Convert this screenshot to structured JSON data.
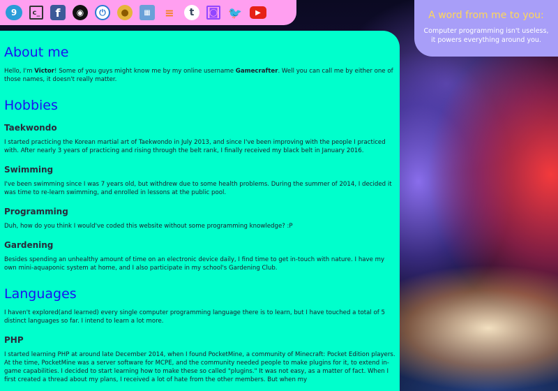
{
  "social_icons": [
    {
      "name": "ninth-icon",
      "glyph": "9"
    },
    {
      "name": "code-icon",
      "glyph": "c_"
    },
    {
      "name": "facebook-icon",
      "glyph": "f"
    },
    {
      "name": "github-icon",
      "glyph": "◉"
    },
    {
      "name": "power-icon",
      "glyph": "⏻"
    },
    {
      "name": "coin-icon",
      "glyph": "●"
    },
    {
      "name": "pixel-icon",
      "glyph": "▦"
    },
    {
      "name": "stackoverflow-icon",
      "glyph": "≡"
    },
    {
      "name": "tumblr-icon",
      "glyph": "t"
    },
    {
      "name": "twitch-icon",
      "glyph": "◙"
    },
    {
      "name": "twitter-icon",
      "glyph": "🐦"
    },
    {
      "name": "youtube-icon",
      "glyph": "▶"
    }
  ],
  "quote": {
    "title": "A word from me to you:",
    "text": "Computer programming isn't useless, it powers everything around you."
  },
  "about": {
    "title": "About me",
    "p1_a": "Hello, I'm ",
    "name": "Victor",
    "p1_b": "! Some of you guys might know me by my online username ",
    "username": "Gamecrafter",
    "p1_c": ". Well you can call me by either one of those names, it doesn't really matter."
  },
  "hobbies": {
    "title": "Hobbies",
    "items": [
      {
        "heading": "Taekwondo",
        "text": "I started practicing the Korean martial art of Taekwondo in July 2013, and since I've been improving with the people I practiced with. After nearly 3 years of practicing and rising through the belt rank, I finally received my black belt in January 2016."
      },
      {
        "heading": "Swimming",
        "text": "I've been swimming since I was 7 years old, but withdrew due to some health problems. During the summer of 2014, I decided it was time to re-learn swimming, and enrolled in lessons at the public pool."
      },
      {
        "heading": "Programming",
        "text": "Duh, how do you think I would've coded this website without some programming knowledge? :P"
      },
      {
        "heading": "Gardening",
        "text": "Besides spending an unhealthy amount of time on an electronic device daily, I find time to get in-touch with nature. I have my own mini-aquaponic system at home, and I also participate in my school's Gardening Club."
      }
    ]
  },
  "languages": {
    "title": "Languages",
    "intro": "I haven't explored(and learned) every single computer programming language there is to learn, but I have touched a total of 5 distinct languages so far. I intend to learn a lot more.",
    "php_heading": "PHP",
    "php_text": "I started learning PHP at around late December 2014, when I found PocketMine, a community of Minecraft: Pocket Edition players. At the time, PocketMine was a server software for MCPE, and the community needed people to make plugins for it, to extend in-game capabilities. I decided to start learning how to make these so called \"plugins.\" It was not easy, as a matter of fact. When I first created a thread about my plans, I received a lot of hate from the other members. But when my"
  },
  "colors": {
    "panel_bg": "#00ffcc",
    "heading": "#1a10f2",
    "topbar_bg": "#ff9ff0",
    "quote_bg": "#a89ef8",
    "quote_title": "#ffd75a"
  }
}
